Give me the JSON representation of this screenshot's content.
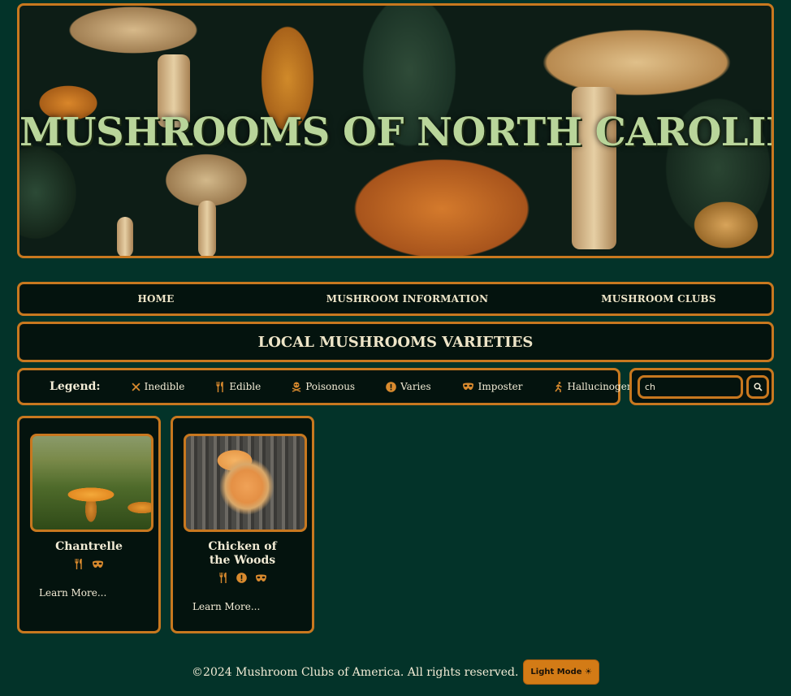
{
  "banner": {
    "title": "MUSHROOMS OF NORTH CAROLINA"
  },
  "nav": {
    "items": [
      {
        "label": "HOME"
      },
      {
        "label": "MUSHROOM INFORMATION"
      },
      {
        "label": "MUSHROOM CLUBS"
      }
    ]
  },
  "section": {
    "title": "LOCAL MUSHROOMS VARIETIES"
  },
  "legend": {
    "label": "Legend:",
    "items": [
      {
        "label": "Inedible",
        "icon": "x-icon"
      },
      {
        "label": "Edible",
        "icon": "utensils-icon"
      },
      {
        "label": "Poisonous",
        "icon": "skull-crossbones-icon"
      },
      {
        "label": "Varies",
        "icon": "exclamation-circle-icon"
      },
      {
        "label": "Imposter",
        "icon": "mask-icon"
      },
      {
        "label": "Hallucinogenic",
        "icon": "running-figure-icon"
      }
    ]
  },
  "search": {
    "value": "ch",
    "icon": "search-icon"
  },
  "cards": [
    {
      "name": "Chantrelle",
      "icons": [
        "utensils-icon",
        "mask-icon"
      ],
      "link": "Learn More..."
    },
    {
      "name": "Chicken of the Woods",
      "icons": [
        "utensils-icon",
        "exclamation-circle-icon",
        "mask-icon"
      ],
      "link": "Learn More..."
    }
  ],
  "footer": {
    "text": "©2024 Mushroom Clubs of America. All rights reserved.",
    "theme_button": "Light Mode ☀"
  },
  "colors": {
    "background": "#033329",
    "accent": "#c8781f",
    "panel": "#04130e",
    "banner_title": "#b9d59a"
  }
}
